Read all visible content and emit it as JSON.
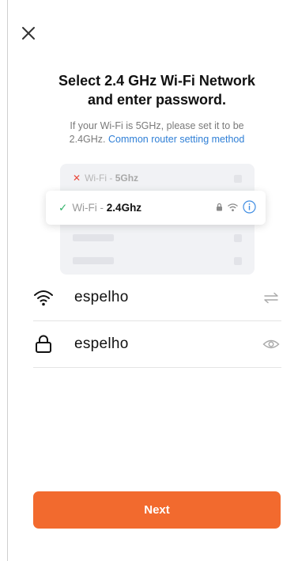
{
  "header": {
    "close_icon": "close-icon"
  },
  "title": {
    "line1": "Select 2.4 GHz Wi-Fi Network",
    "line2": "and enter password."
  },
  "subtitle": {
    "text_line1": "If your Wi-Fi is 5GHz, please set it to be",
    "text_line2": "2.4GHz.",
    "link": "Common router setting method"
  },
  "illustration": {
    "row_5ghz": {
      "prefix": "Wi-Fi - ",
      "band": "5Ghz"
    },
    "row_24ghz": {
      "prefix": "Wi-Fi - ",
      "band": "2.4Ghz"
    }
  },
  "form": {
    "ssid": {
      "value": "espelho",
      "icon": "wifi-icon",
      "action_icon": "switch-network-icon"
    },
    "password": {
      "value": "espelho",
      "icon": "lock-icon",
      "action_icon": "eye-icon"
    }
  },
  "footer": {
    "next_label": "Next"
  },
  "colors": {
    "accent": "#f26a2e",
    "link": "#2f7fd6",
    "check": "#33b36b",
    "cross": "#e9473a"
  }
}
